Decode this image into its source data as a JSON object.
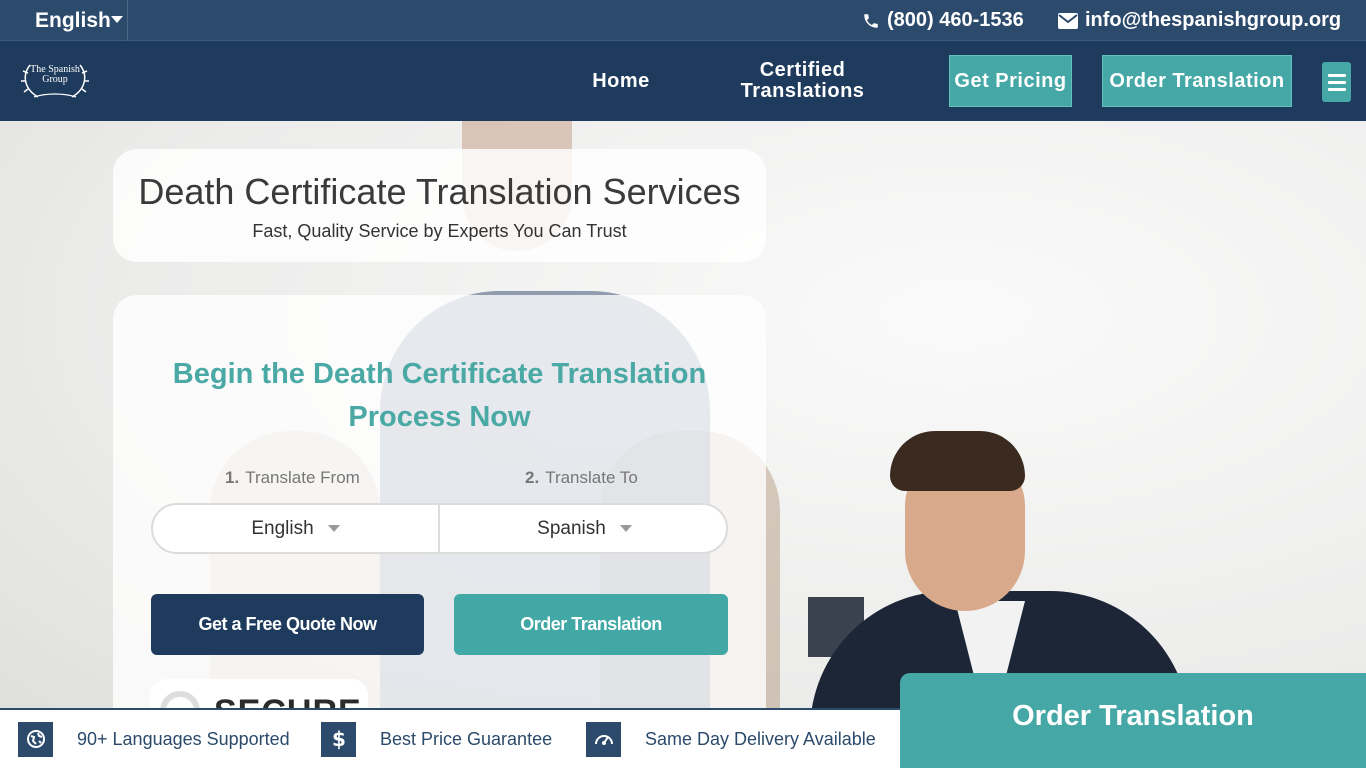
{
  "topbar": {
    "language": "English",
    "phone": "(800) 460-1536",
    "email": "info@thespanishgroup.org"
  },
  "nav": {
    "logo_text": "The Spanish Group",
    "home": "Home",
    "certified": "Certified Translations",
    "pricing": "Get Pricing",
    "order": "Order Translation"
  },
  "hero": {
    "title": "Death Certificate Translation Services",
    "subtitle": "Fast, Quality Service by Experts You Can Trust"
  },
  "form": {
    "title": "Begin the Death Certificate Translation Process Now",
    "step1_num": "1.",
    "step1_label": "Translate From",
    "step2_num": "2.",
    "step2_label": "Translate To",
    "from_value": "English",
    "to_value": "Spanish",
    "quote_button": "Get a Free Quote Now",
    "order_button": "Order Translation",
    "secure_text": "SECURE"
  },
  "features": [
    {
      "label": "90+ Languages Supported",
      "icon": "globe-icon"
    },
    {
      "label": "Best Price Guarantee",
      "icon": "dollar-icon"
    },
    {
      "label": "Same Day Delivery Available",
      "icon": "speedometer-icon"
    }
  ],
  "floating_order": "Order Translation",
  "colors": {
    "navy": "#1e3a5c",
    "topbar": "#2c4a6b",
    "teal": "#45a8a6"
  }
}
